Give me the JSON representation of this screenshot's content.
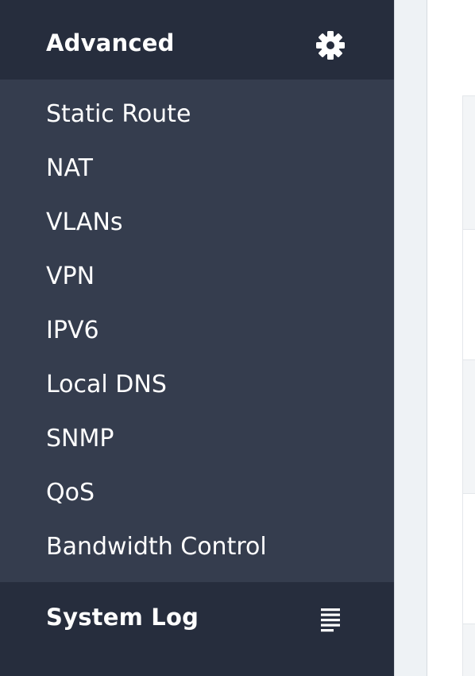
{
  "sidebar": {
    "advanced": {
      "title": "Advanced",
      "icon": "gear-icon"
    },
    "submenu": [
      {
        "label": "Static Route"
      },
      {
        "label": "NAT"
      },
      {
        "label": "VLANs"
      },
      {
        "label": "VPN"
      },
      {
        "label": "IPV6"
      },
      {
        "label": "Local DNS"
      },
      {
        "label": "SNMP"
      },
      {
        "label": "QoS"
      },
      {
        "label": "Bandwidth Control"
      }
    ],
    "system_log": {
      "title": "System Log",
      "icon": "list-icon"
    }
  },
  "colors": {
    "header_bg": "#262d3d",
    "submenu_bg": "#353d4e",
    "text": "#ffffff",
    "gutter_bg": "#eef2f5"
  }
}
